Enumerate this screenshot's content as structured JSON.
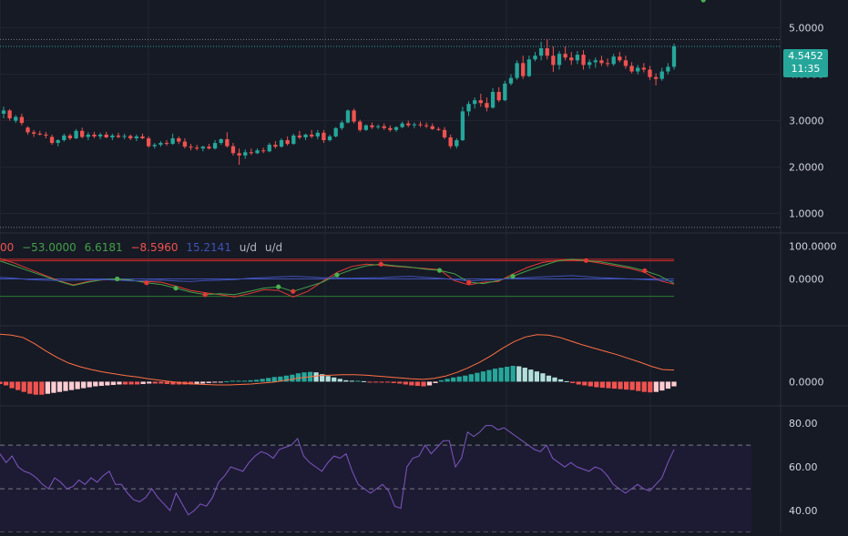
{
  "colors": {
    "background": "#161a25",
    "grid": "#232632",
    "pane_separator": "#2a2e39",
    "up": "#26a69a",
    "down": "#ef5350",
    "stoch_k": "#e53935",
    "stoch_d": "#43a047",
    "stoch_blue": "#3f51b5",
    "stoch_upper_band": "#c62828",
    "stoch_lower_band": "#2e7d32",
    "macd_signal": "#ff7043",
    "hist_green_strong": "#26a69a",
    "hist_green_light": "#b2dfdb",
    "hist_red_strong": "#ef5350",
    "hist_red_light": "#ffcdd2",
    "rsi_line": "#7e57c2",
    "rsi_band_fill": "#1d1b33",
    "price_badge": "#26a69a"
  },
  "price_badge": {
    "price": "4.5452",
    "countdown": "11:35"
  },
  "legend": {
    "v1": "00",
    "v2": "−53.0000",
    "v3": "6.6181",
    "v4": "−8.5960",
    "v5": "15.2141",
    "v6": "u/d",
    "v7": "u/d"
  },
  "chart_data": [
    {
      "type": "candlestick",
      "y_ticks": [
        "5.0000",
        "4.0000",
        "3.0000",
        "2.0000",
        "1.0000"
      ],
      "ylim": [
        0.6,
        5.6
      ],
      "reference_lines": [
        4.75,
        0.7
      ],
      "ohlc": [
        [
          3.15,
          3.3,
          3.05,
          3.22
        ],
        [
          3.22,
          3.25,
          3.0,
          3.05
        ],
        [
          3.0,
          3.12,
          2.95,
          3.08
        ],
        [
          3.08,
          3.15,
          2.9,
          2.95
        ],
        [
          2.85,
          2.88,
          2.7,
          2.75
        ],
        [
          2.75,
          2.8,
          2.65,
          2.72
        ],
        [
          2.72,
          2.78,
          2.68,
          2.7
        ],
        [
          2.7,
          2.76,
          2.62,
          2.68
        ],
        [
          2.65,
          2.7,
          2.48,
          2.52
        ],
        [
          2.52,
          2.6,
          2.45,
          2.58
        ],
        [
          2.58,
          2.72,
          2.55,
          2.68
        ],
        [
          2.68,
          2.72,
          2.58,
          2.62
        ],
        [
          2.62,
          2.82,
          2.6,
          2.78
        ],
        [
          2.78,
          2.85,
          2.62,
          2.65
        ],
        [
          2.65,
          2.75,
          2.58,
          2.7
        ],
        [
          2.7,
          2.76,
          2.62,
          2.66
        ],
        [
          2.66,
          2.74,
          2.6,
          2.7
        ],
        [
          2.7,
          2.76,
          2.62,
          2.64
        ],
        [
          2.64,
          2.72,
          2.58,
          2.68
        ],
        [
          2.68,
          2.74,
          2.62,
          2.65
        ],
        [
          2.65,
          2.72,
          2.6,
          2.67
        ],
        [
          2.67,
          2.7,
          2.58,
          2.62
        ],
        [
          2.62,
          2.7,
          2.56,
          2.66
        ],
        [
          2.66,
          2.72,
          2.6,
          2.62
        ],
        [
          2.62,
          2.66,
          2.42,
          2.45
        ],
        [
          2.45,
          2.52,
          2.4,
          2.48
        ],
        [
          2.48,
          2.56,
          2.44,
          2.52
        ],
        [
          2.52,
          2.58,
          2.46,
          2.5
        ],
        [
          2.5,
          2.72,
          2.48,
          2.62
        ],
        [
          2.62,
          2.66,
          2.5,
          2.55
        ],
        [
          2.55,
          2.62,
          2.4,
          2.44
        ],
        [
          2.44,
          2.5,
          2.36,
          2.42
        ],
        [
          2.42,
          2.48,
          2.36,
          2.4
        ],
        [
          2.4,
          2.46,
          2.34,
          2.44
        ],
        [
          2.44,
          2.5,
          2.38,
          2.4
        ],
        [
          2.4,
          2.58,
          2.38,
          2.52
        ],
        [
          2.52,
          2.62,
          2.48,
          2.6
        ],
        [
          2.6,
          2.75,
          2.42,
          2.45
        ],
        [
          2.45,
          2.52,
          2.25,
          2.3
        ],
        [
          2.3,
          2.4,
          2.05,
          2.25
        ],
        [
          2.25,
          2.38,
          2.18,
          2.32
        ],
        [
          2.32,
          2.4,
          2.26,
          2.3
        ],
        [
          2.3,
          2.4,
          2.28,
          2.36
        ],
        [
          2.36,
          2.42,
          2.3,
          2.34
        ],
        [
          2.34,
          2.52,
          2.32,
          2.48
        ],
        [
          2.48,
          2.56,
          2.4,
          2.44
        ],
        [
          2.44,
          2.62,
          2.42,
          2.58
        ],
        [
          2.58,
          2.66,
          2.46,
          2.5
        ],
        [
          2.5,
          2.72,
          2.48,
          2.68
        ],
        [
          2.68,
          2.78,
          2.6,
          2.64
        ],
        [
          2.64,
          2.72,
          2.58,
          2.7
        ],
        [
          2.7,
          2.8,
          2.62,
          2.66
        ],
        [
          2.66,
          2.8,
          2.6,
          2.74
        ],
        [
          2.74,
          2.8,
          2.52,
          2.58
        ],
        [
          2.58,
          2.7,
          2.55,
          2.66
        ],
        [
          2.66,
          2.86,
          2.64,
          2.84
        ],
        [
          2.84,
          3.0,
          2.8,
          2.96
        ],
        [
          2.96,
          3.24,
          2.94,
          3.22
        ],
        [
          3.22,
          3.26,
          2.94,
          2.98
        ],
        [
          2.98,
          3.02,
          2.76,
          2.8
        ],
        [
          2.8,
          2.92,
          2.78,
          2.9
        ],
        [
          2.9,
          2.96,
          2.82,
          2.86
        ],
        [
          2.86,
          2.92,
          2.82,
          2.88
        ],
        [
          2.88,
          2.94,
          2.8,
          2.84
        ],
        [
          2.84,
          2.9,
          2.76,
          2.8
        ],
        [
          2.8,
          2.88,
          2.76,
          2.86
        ],
        [
          2.86,
          2.98,
          2.84,
          2.94
        ],
        [
          2.94,
          3.0,
          2.86,
          2.9
        ],
        [
          2.9,
          2.96,
          2.84,
          2.92
        ],
        [
          2.92,
          2.98,
          2.86,
          2.9
        ],
        [
          2.9,
          2.96,
          2.84,
          2.88
        ],
        [
          2.88,
          2.94,
          2.8,
          2.82
        ],
        [
          2.82,
          2.86,
          2.78,
          2.8
        ],
        [
          2.8,
          2.86,
          2.6,
          2.64
        ],
        [
          2.64,
          2.7,
          2.4,
          2.45
        ],
        [
          2.45,
          2.62,
          2.4,
          2.58
        ],
        [
          2.58,
          3.3,
          2.56,
          3.2
        ],
        [
          3.2,
          3.42,
          3.1,
          3.36
        ],
        [
          3.36,
          3.5,
          3.26,
          3.44
        ],
        [
          3.44,
          3.58,
          3.3,
          3.38
        ],
        [
          3.38,
          3.5,
          3.2,
          3.28
        ],
        [
          3.28,
          3.7,
          3.26,
          3.62
        ],
        [
          3.62,
          3.72,
          3.4,
          3.44
        ],
        [
          3.44,
          3.86,
          3.42,
          3.8
        ],
        [
          3.8,
          4.0,
          3.76,
          3.92
        ],
        [
          3.92,
          4.3,
          3.88,
          4.24
        ],
        [
          4.24,
          4.4,
          3.9,
          3.96
        ],
        [
          3.96,
          4.4,
          3.94,
          4.32
        ],
        [
          4.32,
          4.48,
          4.28,
          4.4
        ],
        [
          4.4,
          4.7,
          4.3,
          4.56
        ],
        [
          4.56,
          4.75,
          4.32,
          4.4
        ],
        [
          4.4,
          4.6,
          4.05,
          4.2
        ],
        [
          4.2,
          4.5,
          4.1,
          4.44
        ],
        [
          4.44,
          4.6,
          4.3,
          4.36
        ],
        [
          4.36,
          4.48,
          4.2,
          4.3
        ],
        [
          4.3,
          4.5,
          4.22,
          4.42
        ],
        [
          4.42,
          4.52,
          4.1,
          4.2
        ],
        [
          4.2,
          4.32,
          4.12,
          4.26
        ],
        [
          4.26,
          4.36,
          4.14,
          4.3
        ],
        [
          4.3,
          4.4,
          4.18,
          4.24
        ],
        [
          4.24,
          4.34,
          4.16,
          4.22
        ],
        [
          4.22,
          4.44,
          4.18,
          4.38
        ],
        [
          4.38,
          4.48,
          4.26,
          4.3
        ],
        [
          4.3,
          4.4,
          4.12,
          4.18
        ],
        [
          4.18,
          4.26,
          4.02,
          4.06
        ],
        [
          4.06,
          4.2,
          4.0,
          4.14
        ],
        [
          4.14,
          4.24,
          4.04,
          4.1
        ],
        [
          4.1,
          4.18,
          3.88,
          3.94
        ],
        [
          3.94,
          4.02,
          3.76,
          3.9
        ],
        [
          3.9,
          4.14,
          3.86,
          4.06
        ],
        [
          4.06,
          4.24,
          4.0,
          4.16
        ],
        [
          4.16,
          4.66,
          4.1,
          4.6
        ]
      ]
    },
    {
      "type": "line",
      "y_ticks": [
        "100.0000",
        "0.0000"
      ],
      "ylim": [
        -140,
        140
      ],
      "bands": [
        60,
        55,
        -53
      ],
      "zero_line": 0,
      "series": [
        {
          "values": [
            62,
            48,
            30,
            12,
            -5,
            -18,
            -8,
            -3,
            -2,
            -5,
            -8,
            -10,
            -22,
            -35,
            -42,
            -48,
            -55,
            -45,
            -33,
            -35,
            -55,
            -38,
            -8,
            20,
            38,
            45,
            42,
            38,
            35,
            32,
            28,
            -5,
            -18,
            -10,
            -8,
            15,
            35,
            50,
            56,
            58,
            55,
            48,
            40,
            32,
            20,
            -5,
            -16
          ]
        },
        {
          "values": [
            55,
            40,
            24,
            9,
            -7,
            -20,
            -10,
            -2,
            0,
            -4,
            -12,
            -17,
            -28,
            -40,
            -48,
            -45,
            -48,
            -38,
            -28,
            -24,
            -38,
            -24,
            -10,
            12,
            28,
            40,
            45,
            40,
            36,
            30,
            26,
            16,
            -10,
            -14,
            -5,
            8,
            25,
            40,
            54,
            60,
            56,
            52,
            44,
            36,
            25,
            10,
            -14
          ]
        },
        {
          "values": [
            5,
            2,
            -2,
            -4,
            -5,
            -4,
            -3,
            -2,
            -4,
            -6,
            -5,
            -4,
            -6,
            -8,
            -5,
            -4,
            -2,
            2,
            4,
            6,
            8,
            6,
            4,
            3,
            2,
            3,
            4,
            6,
            8,
            5,
            2,
            -2,
            -6,
            -4,
            -2,
            2,
            4,
            6,
            8,
            10,
            7,
            4,
            2,
            0,
            -2,
            -4,
            -6
          ]
        }
      ],
      "markers": [
        {
          "i": 8,
          "color": "green"
        },
        {
          "i": 10,
          "color": "red"
        },
        {
          "i": 12,
          "color": "green"
        },
        {
          "i": 14,
          "color": "red"
        },
        {
          "i": 19,
          "color": "green"
        },
        {
          "i": 20,
          "color": "red"
        },
        {
          "i": 23,
          "color": "green"
        },
        {
          "i": 26,
          "color": "red"
        },
        {
          "i": 30,
          "color": "green"
        },
        {
          "i": 32,
          "color": "red"
        },
        {
          "i": 35,
          "color": "green"
        },
        {
          "i": 40,
          "color": "red"
        },
        {
          "i": 44,
          "color": "red"
        },
        {
          "i": 48,
          "color": "green"
        }
      ]
    },
    {
      "type": "bar",
      "y_ticks": [
        "0.0000"
      ],
      "ylim": [
        -0.5,
        1.2
      ],
      "histogram": [
        -0.05,
        -0.08,
        -0.14,
        -0.18,
        -0.22,
        -0.26,
        -0.28,
        -0.28,
        -0.26,
        -0.24,
        -0.22,
        -0.2,
        -0.18,
        -0.16,
        -0.14,
        -0.12,
        -0.1,
        -0.09,
        -0.08,
        -0.07,
        -0.06,
        -0.06,
        -0.06,
        -0.06,
        -0.05,
        -0.04,
        -0.04,
        -0.04,
        -0.05,
        -0.06,
        -0.06,
        -0.06,
        -0.06,
        -0.05,
        -0.04,
        -0.03,
        -0.02,
        -0.01,
        0.01,
        0.02,
        0.02,
        0.02,
        0.03,
        0.04,
        0.06,
        0.08,
        0.1,
        0.11,
        0.13,
        0.15,
        0.18,
        0.2,
        0.21,
        0.2,
        0.16,
        0.12,
        0.09,
        0.06,
        0.03,
        0.02,
        0.02,
        0.01,
        -0.01,
        -0.01,
        -0.02,
        -0.02,
        -0.03,
        -0.04,
        -0.06,
        -0.08,
        -0.09,
        -0.1,
        -0.08,
        -0.03,
        0.03,
        0.06,
        0.09,
        0.11,
        0.13,
        0.16,
        0.19,
        0.22,
        0.25,
        0.28,
        0.3,
        0.32,
        0.34,
        0.33,
        0.3,
        0.26,
        0.22,
        0.18,
        0.13,
        0.09,
        0.05,
        0.01,
        -0.03,
        -0.06,
        -0.08,
        -0.1,
        -0.12,
        -0.13,
        -0.14,
        -0.15,
        -0.16,
        -0.17,
        -0.18,
        -0.2,
        -0.22,
        -0.23,
        -0.22,
        -0.19,
        -0.15,
        -0.1
      ],
      "signal": [
        1.02,
        1.0,
        0.95,
        0.82,
        0.66,
        0.52,
        0.4,
        0.32,
        0.26,
        0.21,
        0.17,
        0.13,
        0.1,
        0.06,
        0.03,
        0.0,
        -0.03,
        -0.05,
        -0.06,
        -0.07,
        -0.07,
        -0.06,
        -0.05,
        -0.03,
        -0.01,
        0.03,
        0.07,
        0.1,
        0.13,
        0.14,
        0.15,
        0.15,
        0.14,
        0.12,
        0.1,
        0.08,
        0.06,
        0.05,
        0.07,
        0.12,
        0.2,
        0.3,
        0.42,
        0.56,
        0.72,
        0.86,
        0.96,
        1.01,
        1.0,
        0.95,
        0.87,
        0.79,
        0.72,
        0.65,
        0.58,
        0.5,
        0.42,
        0.33,
        0.26,
        0.25
      ]
    },
    {
      "type": "line",
      "y_ticks": [
        "80.00",
        "60.00",
        "40.00"
      ],
      "ylim": [
        30,
        88
      ],
      "bands": [
        70,
        50,
        30
      ],
      "series": [
        {
          "values": [
            66,
            62,
            65,
            60,
            58,
            57,
            55,
            52,
            50,
            55,
            53,
            50,
            51,
            54,
            52,
            55,
            53,
            56,
            58,
            52,
            52,
            48,
            45,
            44,
            46,
            50,
            46,
            43,
            40,
            48,
            43,
            38,
            40,
            43,
            42,
            46,
            53,
            56,
            60,
            59,
            58,
            62,
            65,
            67,
            66,
            64,
            68,
            69,
            70,
            73,
            65,
            62,
            60,
            58,
            62,
            65,
            64,
            66,
            58,
            52,
            50,
            48,
            50,
            52,
            49,
            42,
            41,
            60,
            64,
            65,
            70,
            66,
            69,
            72,
            72,
            60,
            64,
            76,
            74,
            76,
            79,
            79,
            77,
            78,
            76,
            74,
            72,
            70,
            68,
            67,
            70,
            64,
            62,
            60,
            62,
            60,
            59,
            58,
            60,
            59,
            56,
            52,
            50,
            48,
            50,
            52,
            50,
            49,
            52,
            55,
            62,
            68
          ]
        }
      ]
    }
  ]
}
